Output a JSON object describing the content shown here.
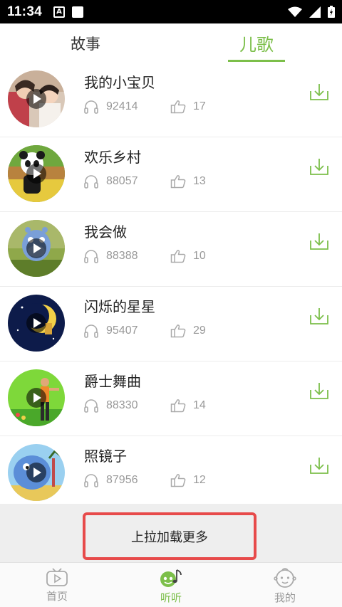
{
  "status_bar": {
    "time": "11:34",
    "a_icon": "A"
  },
  "tabs": [
    {
      "label": "故事",
      "active": false
    },
    {
      "label": "儿歌",
      "active": true
    }
  ],
  "accent_color": "#7cbf4a",
  "songs": [
    {
      "title": "我的小宝贝",
      "plays": "92414",
      "likes": "17",
      "thumb": "children-photo"
    },
    {
      "title": "欢乐乡村",
      "plays": "88057",
      "likes": "13",
      "thumb": "panda-cartoon"
    },
    {
      "title": "我会做",
      "plays": "88388",
      "likes": "10",
      "thumb": "hippo-cartoon"
    },
    {
      "title": "闪烁的星星",
      "plays": "95407",
      "likes": "29",
      "thumb": "moon-night"
    },
    {
      "title": "爵士舞曲",
      "plays": "88330",
      "likes": "14",
      "thumb": "dancer-green"
    },
    {
      "title": "照镜子",
      "plays": "87956",
      "likes": "12",
      "thumb": "blue-elephant"
    }
  ],
  "load_more": "上拉加载更多",
  "bottom_nav": [
    {
      "label": "首页",
      "icon": "tv-icon",
      "active": false
    },
    {
      "label": "听听",
      "icon": "music-note-icon",
      "active": true
    },
    {
      "label": "我的",
      "icon": "baby-face-icon",
      "active": false
    }
  ]
}
